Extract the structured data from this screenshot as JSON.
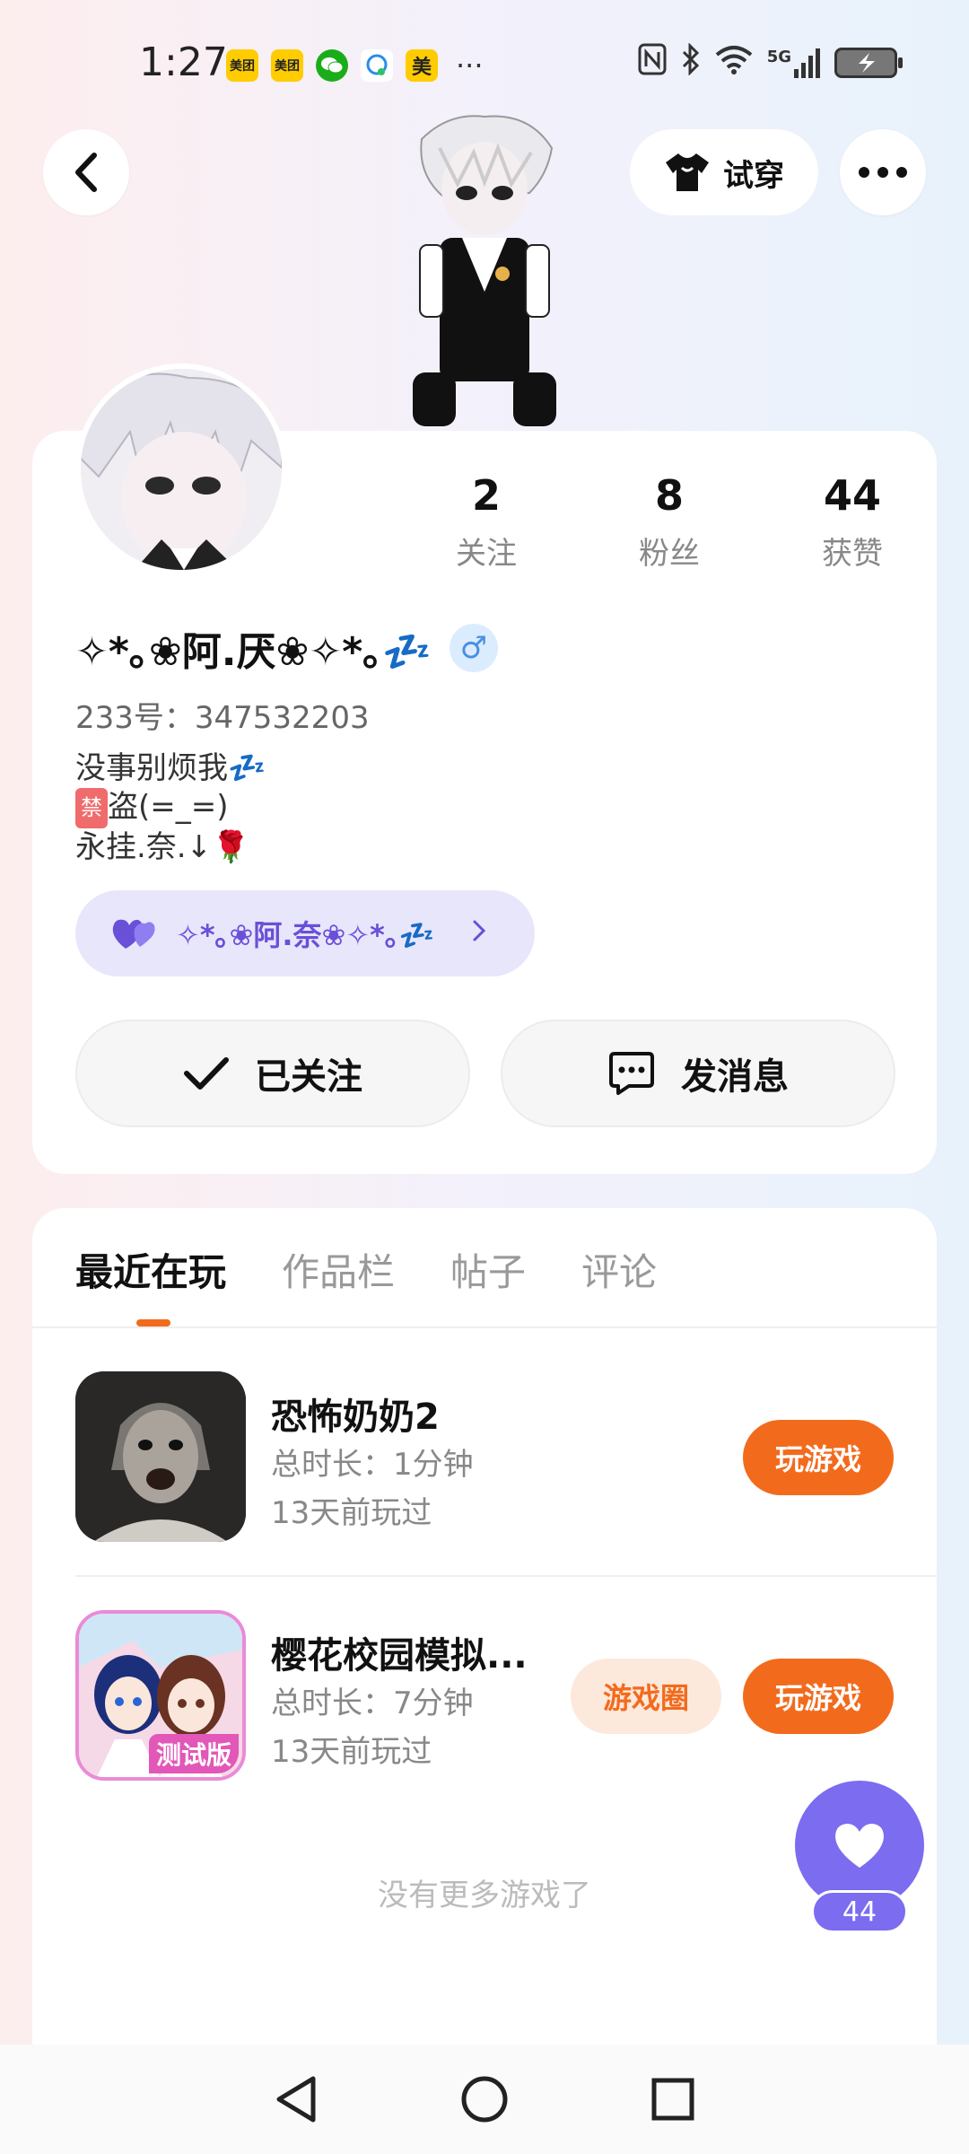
{
  "status_bar": {
    "time": "1:27",
    "app_icons": [
      {
        "name": "meituan-icon",
        "label": "美团",
        "color": "#ffcc00"
      },
      {
        "name": "meituan-icon",
        "label": "美团",
        "color": "#ffcc00"
      },
      {
        "name": "wechat-icon",
        "label": "",
        "color": "#1aad19"
      },
      {
        "name": "bubble-icon",
        "label": "",
        "color": "#ffffff"
      },
      {
        "name": "meituan-icon",
        "label": "美",
        "color": "#ffcc00"
      }
    ],
    "more": "···",
    "network": "5G"
  },
  "header": {
    "try_on_label": "试穿"
  },
  "profile": {
    "nickname": "✧*｡❀阿.厌❀✧*｡💤",
    "gender_symbol": "♂",
    "uid": "233号：347532203",
    "bio_line1": "没事别烦我💤",
    "bio_ban_tag": "禁",
    "bio_line2": "盗(=_=)",
    "bio_line3": "永挂.奈.↓🌹",
    "cp_name": "✧*｡❀阿.奈❀✧*｡💤",
    "stats": [
      {
        "value": "2",
        "label": "关注"
      },
      {
        "value": "8",
        "label": "粉丝"
      },
      {
        "value": "44",
        "label": "获赞"
      }
    ],
    "follow_label": "已关注",
    "message_label": "发消息"
  },
  "tabs": [
    "最近在玩",
    "作品栏",
    "帖子",
    "评论"
  ],
  "games": [
    {
      "title": "恐怖奶奶2",
      "duration": "总时长：1分钟",
      "last_played": "13天前玩过",
      "play_label": "玩游戏"
    },
    {
      "title": "樱花校园模拟...",
      "duration": "总时长：7分钟",
      "last_played": "13天前玩过",
      "circle_label": "游戏圈",
      "play_label": "玩游戏",
      "badge": "测试版"
    }
  ],
  "no_more_label": "没有更多游戏了",
  "like_fab": {
    "count": "44"
  },
  "colors": {
    "accent_orange": "#f26b1d",
    "accent_purple": "#7b6cf0",
    "cp_pill_bg": "#e8e6fb"
  }
}
